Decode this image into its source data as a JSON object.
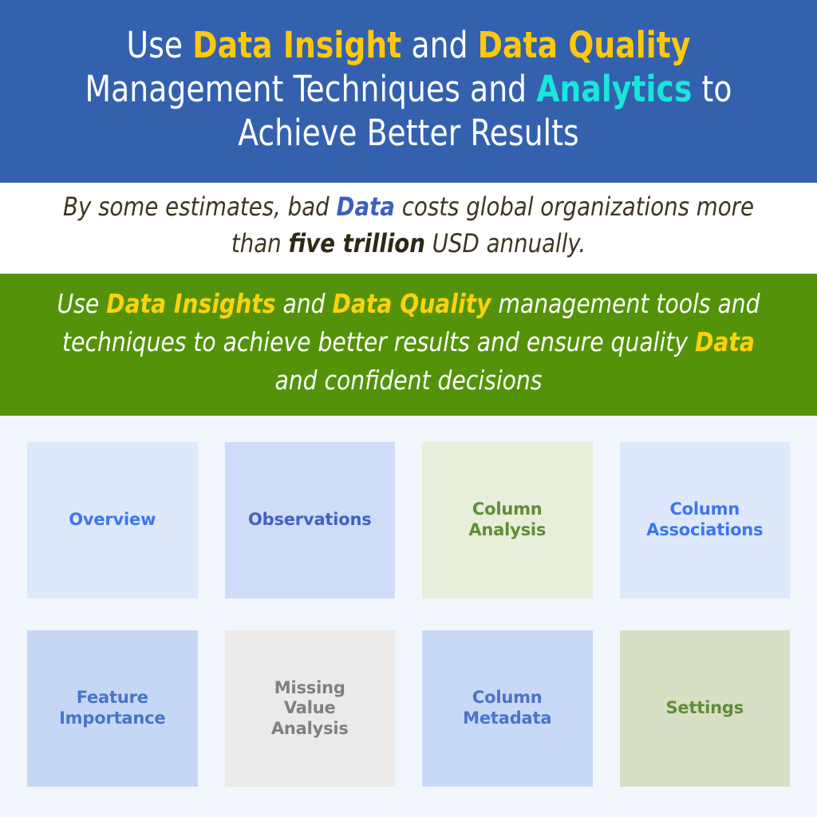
{
  "header": {
    "line1_pre": "Use ",
    "line1_hl1": "Data Insight",
    "line1_mid": " and ",
    "line1_hl2": "Data Quality",
    "line2_pre": "Management Techniques and ",
    "line2_hl": "Analytics",
    "line2_post": " to",
    "line3": "Achieve Better Results",
    "bg_color": "#3461AE",
    "text_color": "#FFFFFF",
    "accent_yellow": "#FFC90B",
    "accent_cyan": "#19E6DB"
  },
  "subtitle": {
    "pre": "By some estimates, bad ",
    "hl_blue": "Data",
    "mid": " costs global organizations more than ",
    "hl_bold": "five trillion",
    "post": " USD annually.",
    "bg_color": "#FFFFFF",
    "text_color": "#3E3520",
    "accent_blue": "#3E5FBF"
  },
  "green_band": {
    "pre": "Use ",
    "hl1": "Data Insights",
    "mid1": " and ",
    "hl2": "Data Quality",
    "mid2": " management tools and techniques to achieve better results and ensure quality ",
    "hl3": "Data",
    "post": " and confident decisions",
    "bg_color": "#549309",
    "text_color": "#FFFFFF",
    "accent_yellow": "#FCD20E"
  },
  "grid": {
    "background": "#F1F7FD",
    "rows": [
      [
        {
          "label": "Overview",
          "bg": "#DEE8FC",
          "fg": "#3B76F0"
        },
        {
          "label": "Observations",
          "bg": "#CEDCF7",
          "fg": "#3F63C4"
        },
        {
          "label": "Column\nAnalysis",
          "bg": "#E7EEDA",
          "fg": "#5E8E36"
        },
        {
          "label": "Column\nAssociations",
          "bg": "#DEE8FC",
          "fg": "#3B76F0"
        }
      ],
      [
        {
          "label": "Feature\nImportance",
          "bg": "#C6D7F6",
          "fg": "#4A74C8"
        },
        {
          "label": "Missing\nValue\nAnalysis",
          "bg": "#EBEAE8",
          "fg": "#808080"
        },
        {
          "label": "Column\nMetadata",
          "bg": "#C8D8F7",
          "fg": "#4A74C8"
        },
        {
          "label": "Settings",
          "bg": "#D7E0C4",
          "fg": "#5E8E36"
        }
      ]
    ]
  }
}
